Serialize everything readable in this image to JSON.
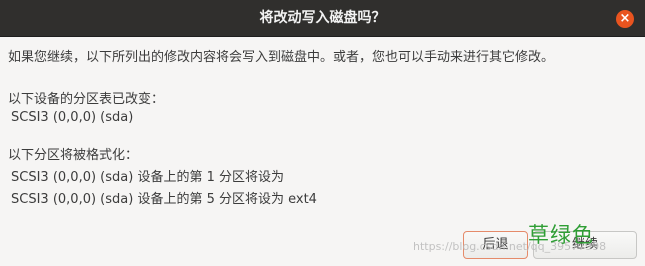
{
  "dialog": {
    "title": "将改动写入磁盘吗？",
    "close_glyph": "×",
    "intro": "如果您继续，以下所列出的修改内容将会写入到磁盘中。或者，您也可以手动来进行其它修改。",
    "partition_tables": {
      "heading": "以下设备的分区表已改变：",
      "items": [
        "SCSI3 (0,0,0) (sda)"
      ]
    },
    "formatted": {
      "heading": "以下分区将被格式化：",
      "items": [
        "SCSI3 (0,0,0) (sda) 设备上的第 1 分区将设为",
        "SCSI3 (0,0,0) (sda) 设备上的第 5 分区将设为 ext4"
      ]
    },
    "buttons": {
      "back": "后退",
      "continue": "继续"
    }
  },
  "watermark": {
    "url": "https://blog.csdn.net/qq_39577998",
    "text": "草绿色"
  },
  "colors": {
    "titlebar": "#302f2d",
    "close_button": "#e9541f",
    "window_bg": "#f6f5f4",
    "watermark_green": "#2f9e35"
  },
  "icons": {
    "close": "close-icon"
  }
}
